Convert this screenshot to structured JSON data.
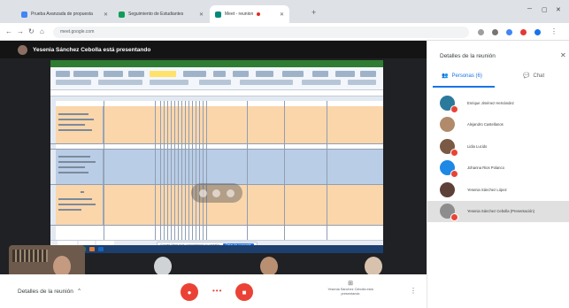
{
  "browser": {
    "tabs": [
      {
        "title": "Prueba Avanzada de propuesta"
      },
      {
        "title": "Seguimiento de Estudiantes"
      },
      {
        "title": "Meet - reunion"
      }
    ],
    "url": "meet.google.com"
  },
  "meet": {
    "presenter_banner": "Yesenia Sánchez Cebolla está presentando",
    "meeting_details_label": "Detalles de la reunión",
    "presenting_label": "Yesenia Sánchez Cebolla está presentando",
    "colors": {
      "end_call": "#ea4335",
      "accent": "#1a73e8"
    }
  },
  "shared_screen": {
    "stop_share_text": "Google Meet está compartiendo tu pantalla",
    "stop_share_button": "Dejar de compartir"
  },
  "side_panel": {
    "title": "Detalles de la reunión",
    "tabs": [
      {
        "label": "Personas (6)",
        "icon": "people-icon"
      },
      {
        "label": "Chat",
        "icon": "chat-icon"
      }
    ],
    "participants": [
      {
        "name": "Enrique Jiménez Hernández",
        "avatar_color": "#2b7a9c"
      },
      {
        "name": "Alejandro Castellanos",
        "avatar_color": "#b08a6a"
      },
      {
        "name": "Lidia Lucido",
        "avatar_color": "#7a5a45"
      },
      {
        "name": "Johanna Rios Polanco",
        "avatar_color": "#1e88e5"
      },
      {
        "name": "Yesenia Sánchez López",
        "avatar_color": "#5d4037"
      },
      {
        "name": "Yesenia Sánchez Cebolla (Presentación)",
        "avatar_color": "#8d8d8d"
      }
    ]
  }
}
